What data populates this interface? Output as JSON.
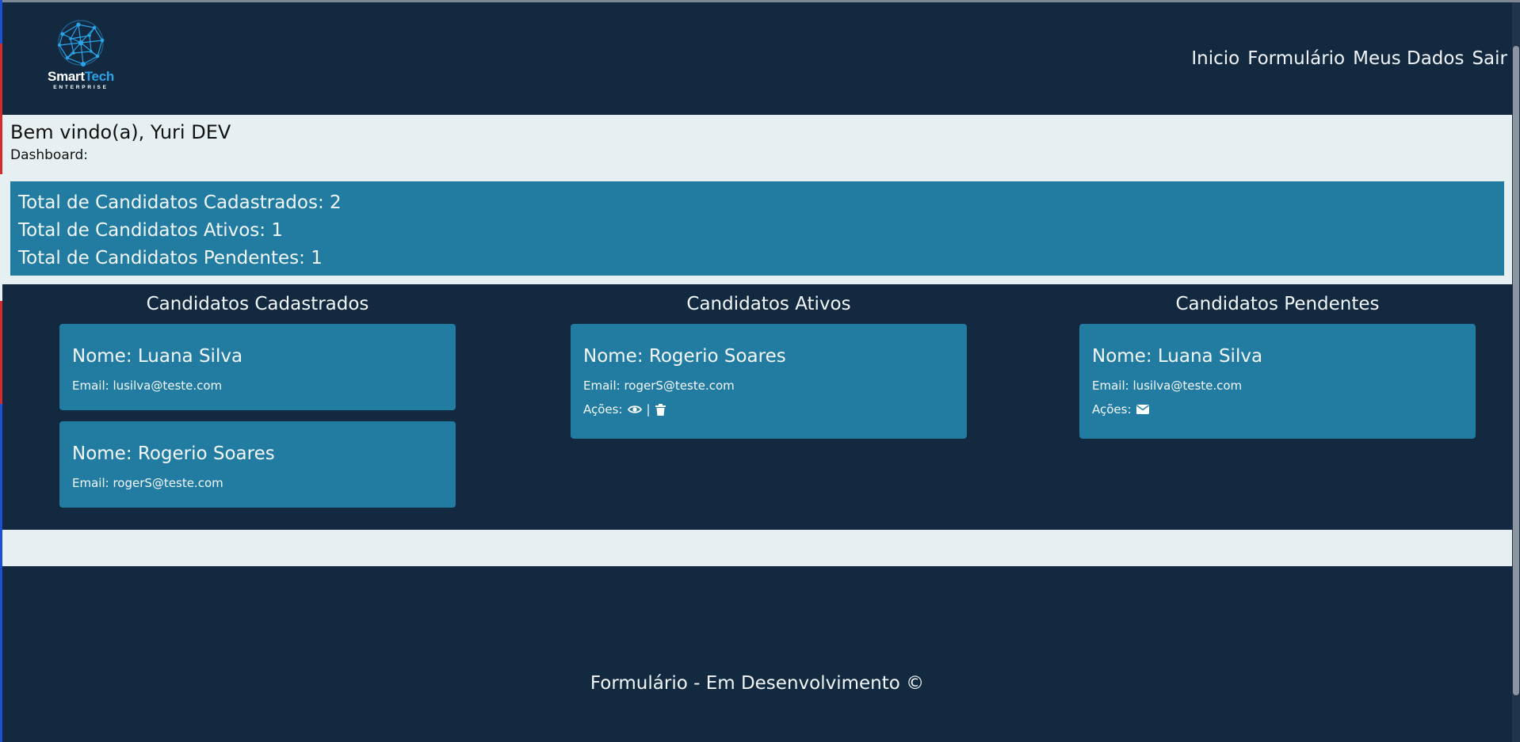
{
  "brand": {
    "name_part1": "Smart",
    "name_part2": "Tech",
    "tagline": "ENTERPRISE",
    "accent_color": "#2aa3e8"
  },
  "nav": {
    "items": [
      {
        "label": "Inicio"
      },
      {
        "label": "Formulário"
      },
      {
        "label": "Meus Dados"
      },
      {
        "label": "Sair"
      }
    ]
  },
  "welcome": {
    "title": "Bem vindo(a), Yuri DEV",
    "subtitle": "Dashboard:"
  },
  "stats": [
    "Total de Candidatos Cadastrados: 2",
    "Total de Candidatos Ativos: 1",
    "Total de Candidatos Pendentes: 1"
  ],
  "columns": {
    "cadastrados": {
      "title": "Candidatos Cadastrados",
      "cards": [
        {
          "name": "Nome: Luana Silva",
          "email": "Email: lusilva@teste.com"
        },
        {
          "name": "Nome: Rogerio Soares",
          "email": "Email: rogerS@teste.com"
        }
      ]
    },
    "ativos": {
      "title": "Candidatos Ativos",
      "cards": [
        {
          "name": "Nome: Rogerio Soares",
          "email": "Email: rogerS@teste.com",
          "actions_label": "Ações:",
          "separator": "|",
          "icons": [
            "eye-icon",
            "trash-icon"
          ]
        }
      ]
    },
    "pendentes": {
      "title": "Candidatos Pendentes",
      "cards": [
        {
          "name": "Nome: Luana Silva",
          "email": "Email: lusilva@teste.com",
          "actions_label": "Ações:",
          "icons": [
            "envelope-icon"
          ]
        }
      ]
    }
  },
  "footer": {
    "text": "Formulário - Em Desenvolvimento ©"
  },
  "colors": {
    "background_dark": "#132940",
    "panel_light": "#e6eff2",
    "card_blue": "#227ca2"
  }
}
